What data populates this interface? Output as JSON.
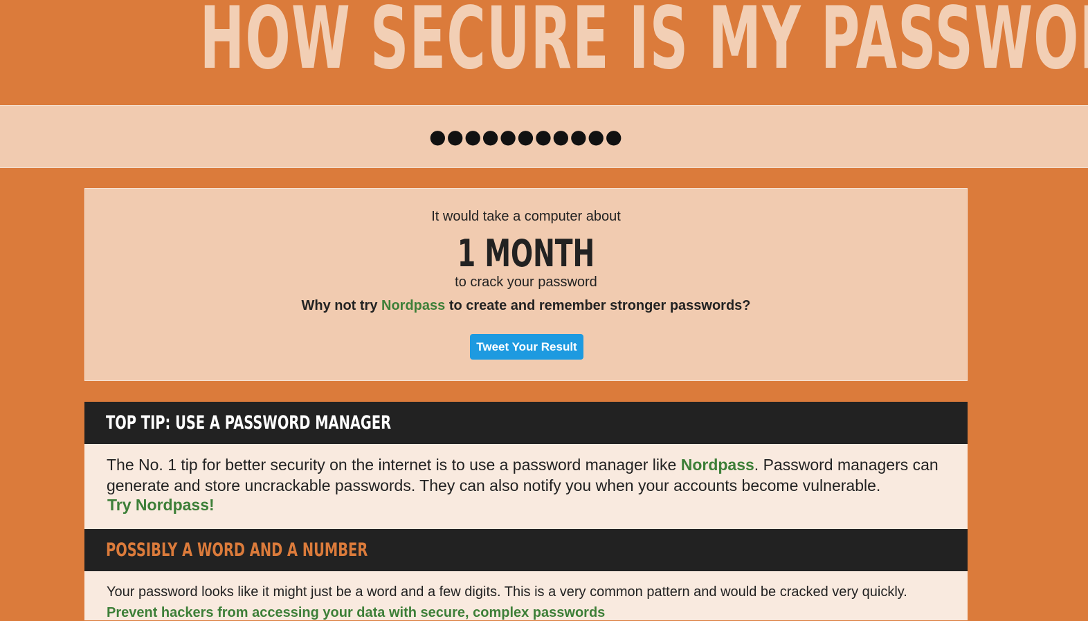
{
  "header": {
    "title": "HOW SECURE IS MY PASSWORD?"
  },
  "password": {
    "masked_value": "●●●●●●●●●●●"
  },
  "result": {
    "intro": "It would take a computer about",
    "time": "1 MONTH",
    "outro": "to crack your password",
    "suggestion_prefix": "Why not try ",
    "suggestion_link": "Nordpass",
    "suggestion_suffix": " to create and remember stronger passwords?",
    "tweet_button": "Tweet Your Result",
    "tweet_button_color": "#1d9ae0"
  },
  "panels": {
    "top_tip": {
      "heading": "TOP TIP: USE A PASSWORD MANAGER",
      "heading_color": "#ffffff",
      "text_prefix": "The No. 1 tip for better security on the internet is to use a password manager like ",
      "text_link": "Nordpass",
      "text_suffix": ". Password managers can generate and store uncrackable passwords. They can also notify you when your accounts become vulnerable.",
      "cta": "Try Nordpass!"
    },
    "pattern": {
      "heading": "POSSIBLY A WORD AND A NUMBER",
      "heading_color": "#db7b3b",
      "text": "Your password looks like it might just be a word and a few digits. This is a very common pattern and would be cracked very quickly.",
      "cta": "Prevent hackers from accessing your data with secure, complex passwords"
    }
  },
  "colors": {
    "background": "#db7b3b",
    "title": "#f2cfb5",
    "band": "#f1cbb0",
    "panel_header": "#222222",
    "panel_body": "#f9eadf",
    "link_green": "#3d7f38"
  }
}
